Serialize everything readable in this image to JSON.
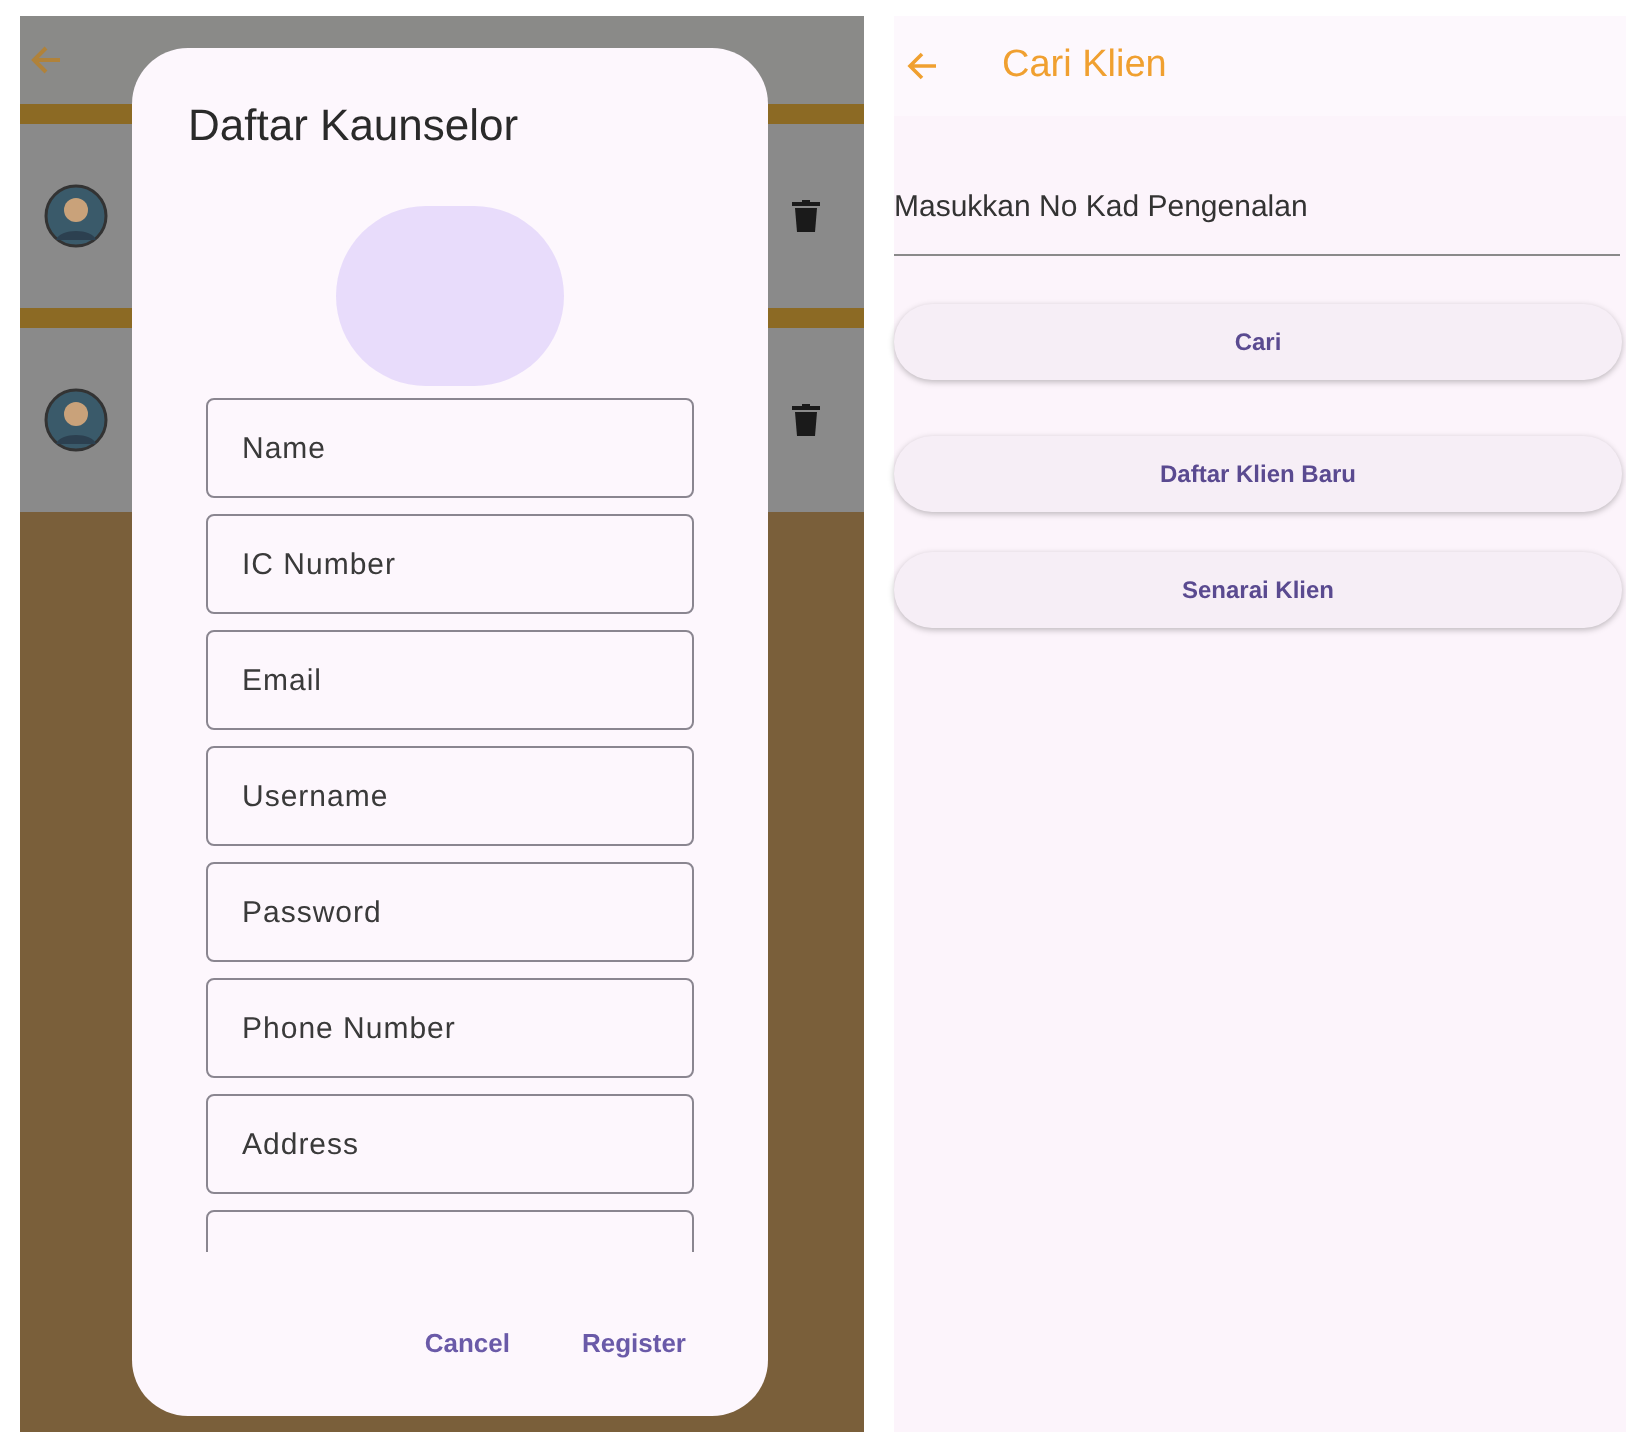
{
  "counselor_screen": {
    "list_items": [
      {
        "kind": "avatar-row"
      },
      {
        "kind": "avatar-row"
      }
    ],
    "dialog": {
      "title": "Daftar Kaunselor",
      "fields": [
        {
          "kind": "text",
          "placeholder": "Name"
        },
        {
          "kind": "text",
          "placeholder": "IC Number"
        },
        {
          "kind": "text",
          "placeholder": "Email"
        },
        {
          "kind": "text",
          "placeholder": "Username"
        },
        {
          "kind": "text",
          "placeholder": "Password"
        },
        {
          "kind": "text",
          "placeholder": "Phone Number"
        },
        {
          "kind": "text",
          "placeholder": "Address"
        },
        {
          "kind": "cut-off"
        }
      ],
      "actions": [
        "Cancel",
        "Register"
      ]
    }
  },
  "client_screen": {
    "title": "Cari Klien",
    "search_field": {
      "placeholder": "Masukkan No Kad Pengenalan"
    },
    "buttons": [
      "Cari",
      "Daftar Klien Baru",
      "Senarai Klien"
    ]
  }
}
